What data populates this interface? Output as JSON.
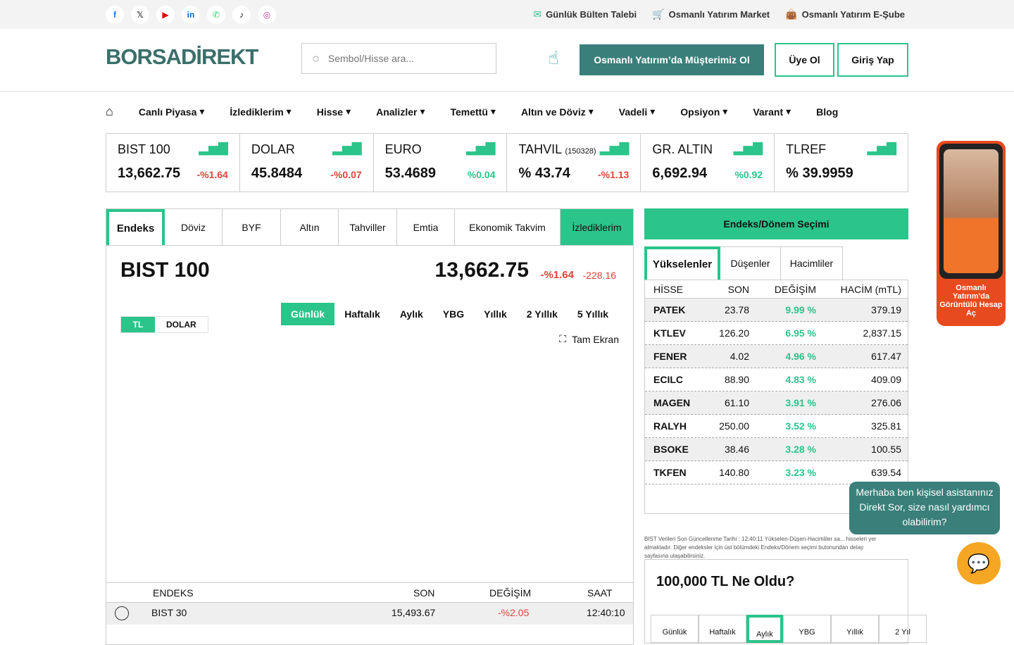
{
  "topbar": {
    "social_icons": [
      "facebook-icon",
      "x-icon",
      "youtube-icon",
      "linkedin-icon",
      "whatsapp-icon",
      "tiktok-icon",
      "instagram-icon"
    ],
    "links": [
      "Günlük Bülten Talebi",
      "Osmanlı Yatırım Market",
      "Osmanlı Yatırım E-Şube"
    ]
  },
  "header": {
    "logo": "BORSADİREKT",
    "search_placeholder": "Sembol/Hisse ara...",
    "cta": "Osmanlı Yatırım’da Müşterimiz Ol",
    "register": "Üye Ol",
    "login": "Giriş Yap"
  },
  "nav": [
    "Canlı Piyasa",
    "İzlediklerim",
    "Hisse",
    "Analizler",
    "Temettü",
    "Altın ve Döviz",
    "Vadeli",
    "Opsiyon",
    "Varant",
    "Blog"
  ],
  "tickers": [
    {
      "name": "BIST 100",
      "sub": "",
      "value": "13,662.75",
      "change": "-%1.64",
      "dir": "neg"
    },
    {
      "name": "DOLAR",
      "sub": "",
      "value": "45.8484",
      "change": "-%0.07",
      "dir": "neg"
    },
    {
      "name": "EURO",
      "sub": "",
      "value": "53.4689",
      "change": "%0.04",
      "dir": "pos"
    },
    {
      "name": "TAHVIL",
      "sub": "(150328)",
      "value": "% 43.74",
      "change": "-%1.13",
      "dir": "neg"
    },
    {
      "name": "GR. ALTIN",
      "sub": "",
      "value": "6,692.94",
      "change": "%0.92",
      "dir": "pos"
    },
    {
      "name": "TLREF",
      "sub": "",
      "value": "% 39.9959",
      "change": "",
      "dir": "pos"
    }
  ],
  "left": {
    "tabs": [
      "Endeks",
      "Döviz",
      "BYF",
      "Altın",
      "Tahviller",
      "Emtia",
      "Ekonomik Takvim",
      "İzlediklerim"
    ],
    "title": "BIST 100",
    "value": "13,662.75",
    "change": "-%1.64",
    "points": "-228.16",
    "currency": [
      "TL",
      "DOLAR"
    ],
    "periods": [
      "Günlük",
      "Haftalık",
      "Aylık",
      "YBG",
      "Yıllık",
      "2 Yıllık",
      "5 Yıllık"
    ],
    "fullscreen": "Tam Ekran",
    "table_head": [
      "ENDEKS",
      "SON",
      "DEĞİŞİM",
      "SAAT"
    ],
    "rows": [
      {
        "name": "BIST 30",
        "son": "15,493.67",
        "degisim": "-%2.05",
        "saat": "12:40:10"
      }
    ]
  },
  "right": {
    "selector": "Endeks/Dönem Seçimi",
    "tabs": [
      "Yükselenler",
      "Düşenler",
      "Hacimliler"
    ],
    "head": [
      "HİSSE",
      "SON",
      "DEĞİŞİM",
      "HACİM (mTL)"
    ],
    "rows": [
      {
        "s": "PATEK",
        "son": "23.78",
        "d": "9.99 %",
        "h": "379.19"
      },
      {
        "s": "KTLEV",
        "son": "126.20",
        "d": "6.95 %",
        "h": "2,837.15"
      },
      {
        "s": "FENER",
        "son": "4.02",
        "d": "4.96 %",
        "h": "617.47"
      },
      {
        "s": "ECILC",
        "son": "88.90",
        "d": "4.83 %",
        "h": "409.09"
      },
      {
        "s": "MAGEN",
        "son": "61.10",
        "d": "3.91 %",
        "h": "276.06"
      },
      {
        "s": "RALYH",
        "son": "250.00",
        "d": "3.52 %",
        "h": "325.81"
      },
      {
        "s": "BSOKE",
        "son": "38.46",
        "d": "3.28 %",
        "h": "100.55"
      },
      {
        "s": "TKFEN",
        "son": "140.80",
        "d": "3.23 %",
        "h": "639.54"
      }
    ],
    "note": "BIST Verileri Son Güncellenme Tarihi : 12:40:11  Yükselen-Düşen-Hacimliler sa... hisseleri yer almaktadır. Diğer endeksler için üst bölümdeki Endeks/Dönem seçimi butonundan detay sayfasına ulaşabilirsiniz.",
    "ne_title": "100,000 TL Ne Oldu?",
    "ne_tabs": [
      "Günlük",
      "Haftalık",
      "Aylık",
      "YBG",
      "Yıllık",
      "2 Yıl"
    ]
  },
  "video_label": "Osmanlı Yatırım'da Görüntülü Hesap Aç",
  "chat_bubble": "Merhaba ben kişisel asistanınız Direkt Sor, size nasıl yardımcı olabilirim?"
}
